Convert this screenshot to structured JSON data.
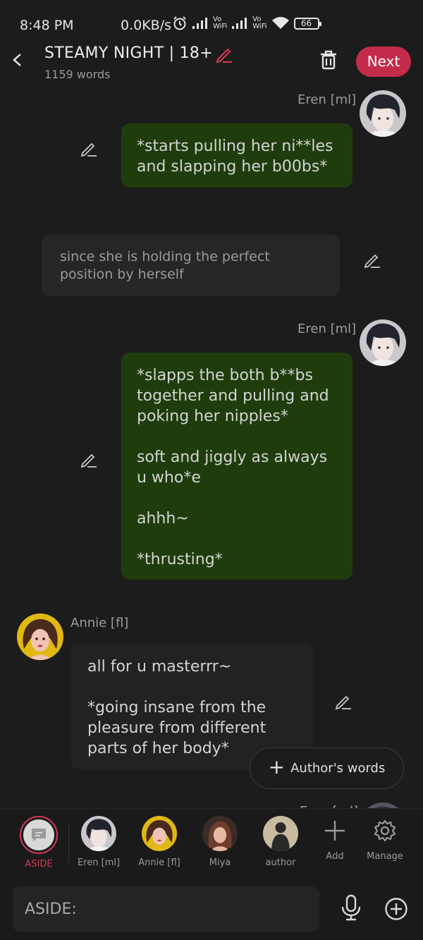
{
  "status_bar": {
    "time": "8:48 PM",
    "net_speed": "0.0KB/s",
    "vowifi_1": "Vo\nWiFi",
    "vowifi_2": "Vo\nWiFi",
    "battery": "66"
  },
  "header": {
    "title": "STEAMY NIGHT | 18+",
    "word_count": "1159 words",
    "next_label": "Next",
    "accent_color": "#c42b4a"
  },
  "messages": [
    {
      "speaker": "Eren [ml]",
      "text": "*starts pulling her ni**les\nand slapping her b00bs*"
    },
    {
      "speaker": "",
      "text": "since she is holding the perfect\nposition by herself"
    },
    {
      "speaker": "Eren [ml]",
      "text": "*slapps the both b**bs\ntogether and pulling and\npoking her nipples*\n\nsoft and jiggly as always\nu who*e\n\nahhh~\n\n*thrusting*"
    },
    {
      "speaker": "Annie [fl]",
      "text": "all for u masterrr~\n\n*going insane from the\npleasure from different\nparts of her body*"
    }
  ],
  "peek_speaker": "Eren [ml]",
  "authors_words_button": "Author's words",
  "characters": [
    {
      "label": "ASIDE",
      "icon": "aside-icon"
    },
    {
      "label": "Eren [ml]",
      "icon": "avatar-eren"
    },
    {
      "label": "Annie [fl]",
      "icon": "avatar-annie"
    },
    {
      "label": "Miya",
      "icon": "avatar-miya"
    },
    {
      "label": "author",
      "icon": "avatar-author"
    }
  ],
  "tools": {
    "add_label": "Add",
    "manage_label": "Manage"
  },
  "composer": {
    "placeholder": "ASIDE:"
  }
}
